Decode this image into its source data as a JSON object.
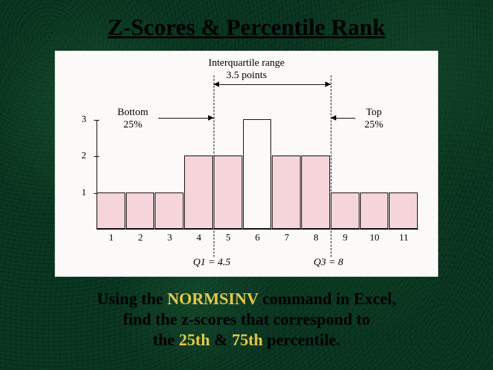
{
  "title": "Z-Scores & Percentile Rank",
  "caption": {
    "line1_pre": "Using the ",
    "line1_hl": "NORMSINV",
    "line1_post": " command in Excel,",
    "line2": "find the z-scores that correspond to",
    "line3_pre": "the ",
    "line3_hl1": "25th",
    "line3_mid": " & ",
    "line3_hl2": "75th",
    "line3_post": " percentile."
  },
  "figure": {
    "iqr_label_l1": "Interquartile range",
    "iqr_label_l2": "3.5 points",
    "bottom_label_l1": "Bottom",
    "bottom_label_l2": "25%",
    "top_label_l1": "Top",
    "top_label_l2": "25%",
    "q1_label": "Q1 = 4.5",
    "q3_label": "Q3 = 8",
    "ylabels": [
      "1",
      "2",
      "3"
    ],
    "xlabels": [
      "1",
      "2",
      "3",
      "4",
      "5",
      "6",
      "7",
      "8",
      "9",
      "10",
      "11"
    ]
  },
  "chart_data": {
    "type": "bar",
    "categories": [
      1,
      2,
      3,
      4,
      5,
      6,
      7,
      8,
      9,
      10,
      11
    ],
    "values": [
      1,
      1,
      1,
      2,
      2,
      3,
      2,
      2,
      1,
      1,
      1
    ],
    "title": "Interquartile range 3.5 points",
    "xlabel": "",
    "ylabel": "",
    "ylim": [
      0,
      3
    ],
    "annotations": {
      "Q1": 4.5,
      "Q3": 8,
      "iqr": 3.5,
      "bottom_pct": 25,
      "top_pct": 25
    }
  }
}
